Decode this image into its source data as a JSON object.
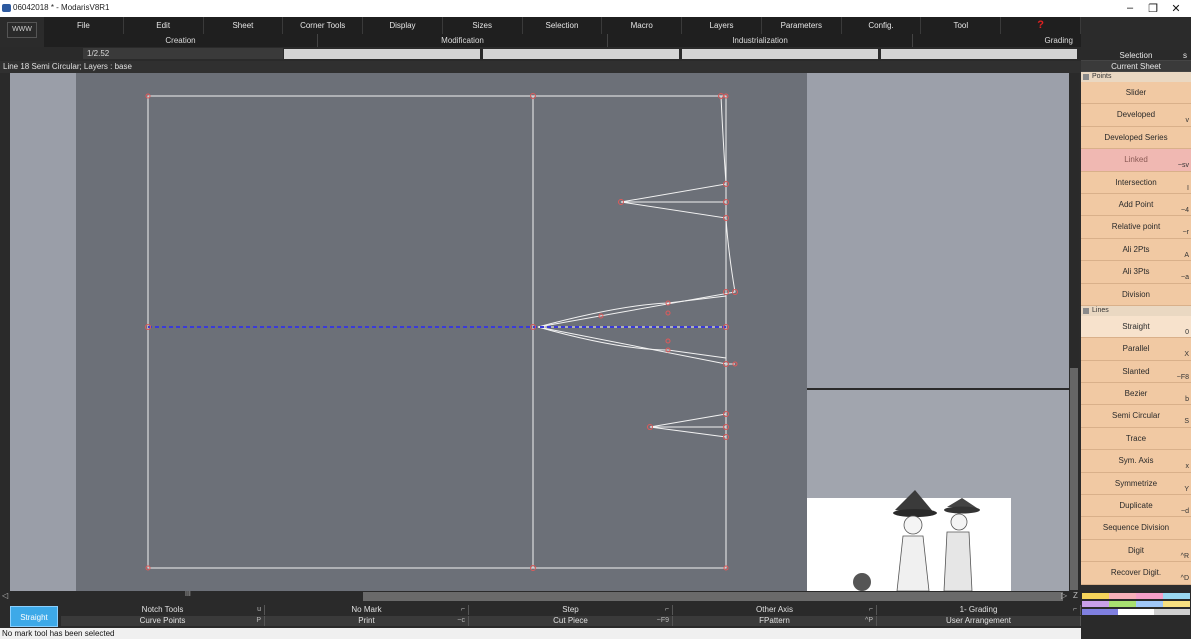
{
  "window": {
    "title": "06042018 * - ModarisV8R1",
    "min": "–",
    "max": "❐",
    "close": "✕"
  },
  "www": "WWW",
  "menu": [
    "File",
    "Edit",
    "Sheet",
    "Corner Tools",
    "Display",
    "Sizes",
    "Selection",
    "Macro",
    "Layers",
    "Parameters",
    "Config.",
    "Tool",
    "?"
  ],
  "categories": [
    "Creation",
    "Modification",
    "Industrialization",
    "Grading"
  ],
  "scale": "1/2.52",
  "status": "Line 18  Semi Circular;   Layers :  base",
  "right_panel": {
    "selection": "Selection",
    "selection_sc": "s",
    "current_sheet": "Current Sheet",
    "points_header": "Points",
    "points": [
      {
        "label": "Slider",
        "sc": ""
      },
      {
        "label": "Developed",
        "sc": "v"
      },
      {
        "label": "Developed Series",
        "sc": ""
      },
      {
        "label": "Linked",
        "sc": "~sv"
      },
      {
        "label": "Intersection",
        "sc": "I"
      },
      {
        "label": "Add Point",
        "sc": "~4"
      },
      {
        "label": "Relative point",
        "sc": "~r"
      },
      {
        "label": "Ali 2Pts",
        "sc": "A"
      },
      {
        "label": "Ali 3Pts",
        "sc": "~a"
      },
      {
        "label": "Division",
        "sc": ""
      }
    ],
    "lines_header": "Lines",
    "lines": [
      {
        "label": "Straight",
        "sc": "0"
      },
      {
        "label": "Parallel",
        "sc": "X"
      },
      {
        "label": "Slanted",
        "sc": "~F8"
      },
      {
        "label": "Bezier",
        "sc": "b"
      },
      {
        "label": "Semi Circular",
        "sc": "S"
      },
      {
        "label": "Trace",
        "sc": ""
      },
      {
        "label": "Sym. Axis",
        "sc": "x"
      },
      {
        "label": "Symmetrize",
        "sc": "Y"
      },
      {
        "label": "Duplicate",
        "sc": "~d"
      },
      {
        "label": "Sequence Division",
        "sc": ""
      },
      {
        "label": "Digit",
        "sc": "^R"
      },
      {
        "label": "Recover Digit.",
        "sc": "^D"
      }
    ]
  },
  "bottom": {
    "active_tool": "Straight",
    "row1": [
      {
        "label": "Notch Tools",
        "sc": "u"
      },
      {
        "label": "No Mark",
        "sc": "⌐"
      },
      {
        "label": "Step",
        "sc": "⌐"
      },
      {
        "label": "Other Axis",
        "sc": "⌐"
      },
      {
        "label": "1- Grading",
        "sc": "⌐"
      }
    ],
    "row2": [
      {
        "label": "Curve Points",
        "sc": "P"
      },
      {
        "label": "Print",
        "sc": "~c"
      },
      {
        "label": "Cut Piece",
        "sc": "~F9"
      },
      {
        "label": "FPattern",
        "sc": "^P"
      },
      {
        "label": "User Arrangement",
        "sc": ""
      }
    ],
    "message": "No mark tool has been selected"
  },
  "canvas": {
    "scroll_left": "◁",
    "scroll_mid": "III",
    "scroll_right": "▷",
    "z": "Z"
  }
}
